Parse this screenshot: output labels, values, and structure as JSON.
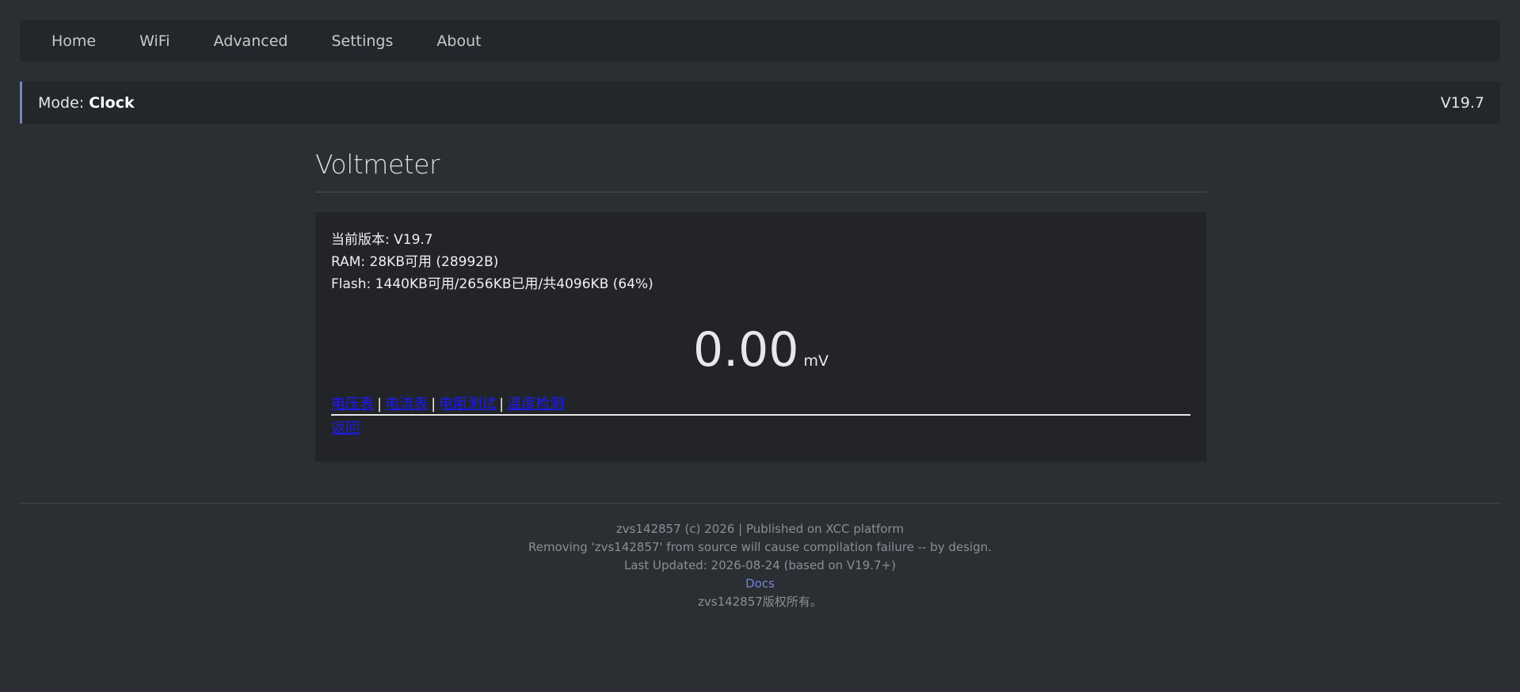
{
  "nav": {
    "items": [
      "Home",
      "WiFi",
      "Advanced",
      "Settings",
      "About"
    ]
  },
  "status": {
    "mode_label": "Mode: ",
    "mode_value": "Clock",
    "version": "V19.7"
  },
  "main": {
    "title": "Voltmeter",
    "info": {
      "version_line": "当前版本: V19.7",
      "ram_line": "RAM: 28KB可用 (28992B)",
      "flash_line": "Flash: 1440KB可用/2656KB已用/共4096KB (64%)"
    },
    "reading": {
      "value": "0.00",
      "unit": "mV"
    },
    "links": [
      "电压表",
      "电流表",
      "电阻测试",
      "温度检测"
    ],
    "separator": "|",
    "back_label": "返回"
  },
  "footer": {
    "line1": "zvs142857 (c) 2026 | Published on XCC platform",
    "line2": "Removing 'zvs142857' from source will cause compilation failure -- by design.",
    "line3": "Last Updated: 2026-08-24 (based on V19.7+)",
    "docs_label": "Docs",
    "line5": "zvs142857版权所有。"
  },
  "colors": {
    "background": "#2b2e33",
    "panel": "#23262a",
    "accent": "#6f86d6",
    "link": "#1a1aff"
  }
}
